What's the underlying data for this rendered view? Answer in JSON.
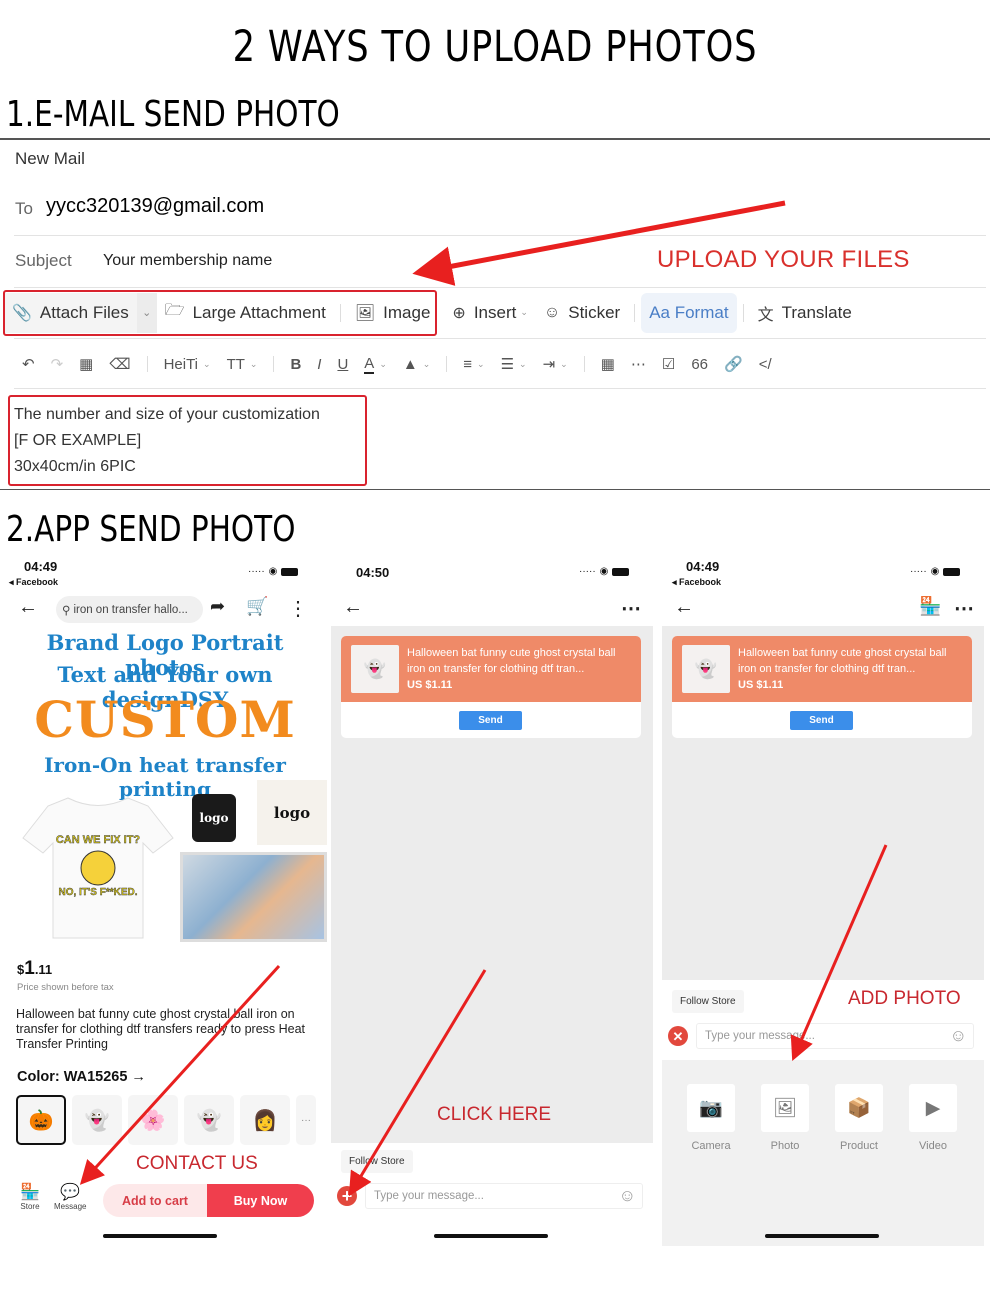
{
  "page_title": "2 WAYS TO UPLOAD PHOTOS",
  "section1": {
    "title": "1.E-MAIL SEND PHOTO",
    "mail": {
      "header": "New Mail",
      "to_label": "To",
      "to_value": "yycc320139@gmail.com",
      "subject_label": "Subject",
      "subject_value": "Your membership name",
      "annotation": "UPLOAD YOUR FILES",
      "toolbar": {
        "attach": "Attach Files",
        "large": "Large Attachment",
        "image": "Image",
        "insert": "Insert",
        "sticker": "Sticker",
        "format": "Aa Format",
        "translate": "Translate"
      },
      "format_bar": {
        "font": "HeiTi",
        "size": "TT",
        "bold": "B",
        "italic": "I",
        "underline": "U",
        "color": "A",
        "quote": "66",
        "code": "</"
      },
      "body_lines": [
        "The number and size of your  customization",
        "[F OR EXAMPLE]",
        "30x40cm/in  6PIC"
      ]
    }
  },
  "section2": {
    "title": "2.APP SEND PHOTO",
    "phone1": {
      "time": "04:49",
      "back_app": "◂ Facebook",
      "search": "iron on transfer hallo...",
      "promo": [
        "Brand Logo  Portrait photos",
        "Text and Your own designDSY",
        "CUSTOM",
        "Iron-On heat transfer printing"
      ],
      "logo_text": "logo",
      "price_currency": "$",
      "price_int": "1",
      "price_dec": ".11",
      "price_note": "Price shown before tax",
      "product_title": "Halloween bat funny cute ghost crystal ball iron on transfer for clothing dtf transfers ready to press Heat Transfer Printing",
      "color_label": "Color: WA15265 →",
      "more": "···",
      "annotation": "CONTACT US",
      "store": "Store",
      "message": "Message",
      "add_to_cart": "Add to cart",
      "buy_now": "Buy Now"
    },
    "phone2": {
      "time": "04:50",
      "card_title": "Halloween bat funny cute ghost crystal ball iron on transfer for clothing dtf tran...",
      "card_price": "US $1.11",
      "send": "Send",
      "follow": "Follow Store",
      "placeholder": "Type your message...",
      "annotation": "CLICK HERE"
    },
    "phone3": {
      "time": "04:49",
      "back_app": "◂ Facebook",
      "card_title": "Halloween bat funny cute ghost crystal ball iron on transfer for clothing dtf tran...",
      "card_price": "US $1.11",
      "send": "Send",
      "follow": "Follow Store",
      "placeholder": "Type your message...",
      "annotation": "ADD PHOTO",
      "tray": [
        "Camera",
        "Photo",
        "Product",
        "Video"
      ]
    }
  },
  "colors": {
    "annotation_red": "#d9302c",
    "accent_blue": "#3b8eea",
    "card_orange": "#ef8a68",
    "buy_red": "#f03e4d"
  }
}
